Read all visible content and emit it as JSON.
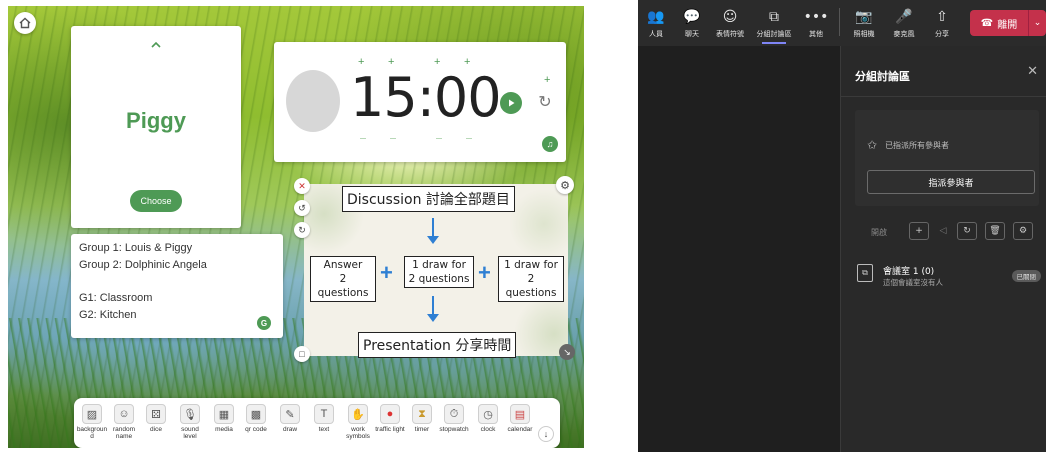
{
  "classroom": {
    "picker": {
      "name": "Piggy",
      "choose_label": "Choose"
    },
    "timer": {
      "time": "15:00"
    },
    "groups": {
      "lines1": [
        "Group 1: Louis & Piggy",
        "Group 2: Dolphinic Angela"
      ],
      "lines2": [
        "G1: Classroom",
        "G2: Kitchen"
      ]
    },
    "board": {
      "title": "Discussion 討論全部題目",
      "steps": [
        {
          "line1": "Answer",
          "line2": "2 questions"
        },
        {
          "line1": "1 draw for",
          "line2": "2 questions"
        },
        {
          "line1": "1 draw for",
          "line2": "2 questions"
        }
      ],
      "plus": "+",
      "footer": "Presentation 分享時間"
    },
    "toolbar": [
      {
        "label": "backgroun d",
        "icon": "image-icon"
      },
      {
        "label": "random name",
        "icon": "random-name-icon"
      },
      {
        "label": "dice",
        "icon": "dice-icon"
      },
      {
        "label": "sound level",
        "icon": "microphone-icon"
      },
      {
        "label": "media",
        "icon": "media-icon"
      },
      {
        "label": "qr code",
        "icon": "qr-code-icon"
      },
      {
        "label": "draw",
        "icon": "pencil-icon"
      },
      {
        "label": "text",
        "icon": "text-icon"
      },
      {
        "label": "work symbols",
        "icon": "work-symbols-icon"
      },
      {
        "label": "traffic light",
        "icon": "traffic-light-icon"
      },
      {
        "label": "timer",
        "icon": "hourglass-icon"
      },
      {
        "label": "stopwatch",
        "icon": "stopwatch-icon"
      },
      {
        "label": "clock",
        "icon": "clock-icon"
      },
      {
        "label": "calendar",
        "icon": "calendar-icon"
      }
    ],
    "colors": {
      "green": "#4e9a55",
      "blue": "#2e7fd3"
    }
  },
  "teams": {
    "topbar": {
      "people": "人員",
      "chat": "聊天",
      "reactions": "表情符號",
      "rooms": "分組討論區",
      "more": "其他",
      "camera": "照相機",
      "mic": "麥克風",
      "share": "分享",
      "leave": "離開"
    },
    "panel": {
      "title": "分組討論區",
      "assigned_status": "已指派所有參與者",
      "assign_button": "指派參與者",
      "open_label": "開啟",
      "room": {
        "name": "會議室 1 (0)",
        "subtitle": "這個會議室沒有人",
        "badge": "已關閉"
      }
    },
    "colors": {
      "leave": "#c4314b",
      "accent": "#7f85f5"
    }
  }
}
